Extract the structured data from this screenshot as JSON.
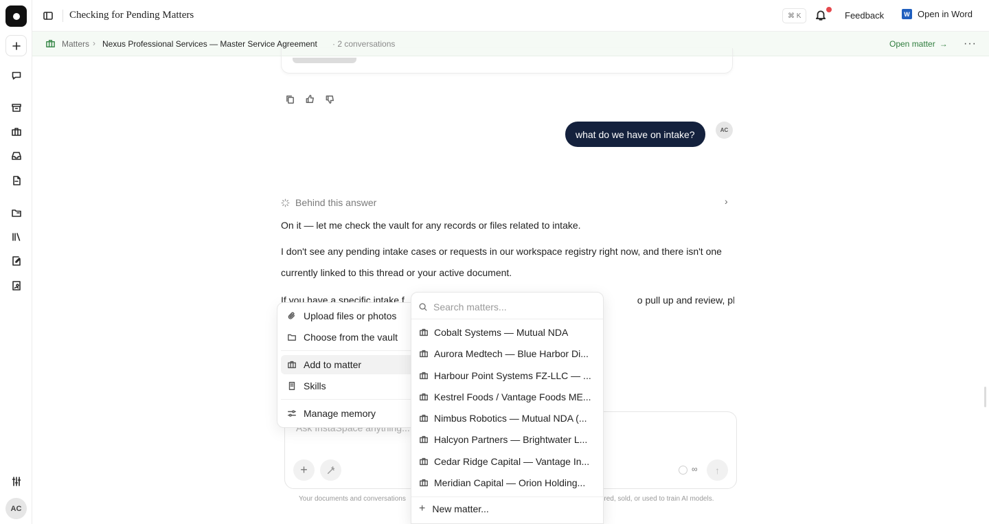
{
  "window": {
    "title": "Checking for Pending Matters"
  },
  "topbar": {
    "shortcut": "⌘ K",
    "feedback_label": "Feedback",
    "open_in_word_label": "Open in Word",
    "word_icon_letter": "W"
  },
  "breadcrumb": {
    "root": "Matters",
    "separator": "›",
    "matter_name": "Nexus Professional Services — Master Service Agreement",
    "conversation_count": "· 2 conversations",
    "open_matter_label": "Open matter",
    "open_matter_arrow": "→",
    "more": "···"
  },
  "sidebar": {
    "user_initials": "AC",
    "items": [
      "logo",
      "new-chat",
      "chats",
      "archive",
      "matters",
      "inbox",
      "documents",
      "folder",
      "library",
      "edit-doc",
      "contacts",
      "settings"
    ]
  },
  "conversation": {
    "user_message": "what do we have on intake?",
    "user_initials": "AC",
    "behind_label": "Behind this answer",
    "behind_chevron": "›",
    "answer_line1": "On it — let me check the vault for any records or files related to intake.",
    "answer_line2": "I don't see any pending intake cases or requests in our workspace registry right now, and there isn't one currently linked to this thread or your active document.",
    "answer_line3_left": "If you have a specific intake f",
    "answer_line3_right": "o pull up and review, please"
  },
  "composer": {
    "placeholder": "Ask InstaSpace anything...",
    "plus": "+",
    "infinity": "∞",
    "send": "↑",
    "disclaimer_left": "Your documents and conversations",
    "disclaimer_right": "ored, sold, or used to train AI models."
  },
  "attach_menu": {
    "items": [
      {
        "label": "Upload files or photos",
        "icon": "paperclip-icon"
      },
      {
        "label": "Choose from the vault",
        "icon": "folder-icon"
      },
      {
        "label": "Add to matter",
        "icon": "briefcase-icon",
        "active": true
      },
      {
        "label": "Skills",
        "icon": "book-icon"
      },
      {
        "label": "Manage memory",
        "icon": "sliders-icon"
      }
    ]
  },
  "matter_menu": {
    "search_placeholder": "Search matters...",
    "matters": [
      "Cobalt Systems — Mutual NDA",
      "Aurora Medtech — Blue Harbor Di...",
      "Harbour Point Systems FZ-LLC — ...",
      "Kestrel Foods / Vantage Foods ME...",
      "Nimbus Robotics — Mutual NDA (...",
      "Halcyon Partners — Brightwater L...",
      "Cedar Ridge Capital — Vantage In...",
      "Meridian Capital — Orion Holding..."
    ],
    "new_matter_label": "New matter...",
    "new_matter_plus": "+"
  },
  "colors": {
    "accent_green": "#2f7d3e",
    "bubble_navy": "#14213d",
    "notification_red": "#e5484d",
    "word_blue": "#1f5fbf"
  }
}
